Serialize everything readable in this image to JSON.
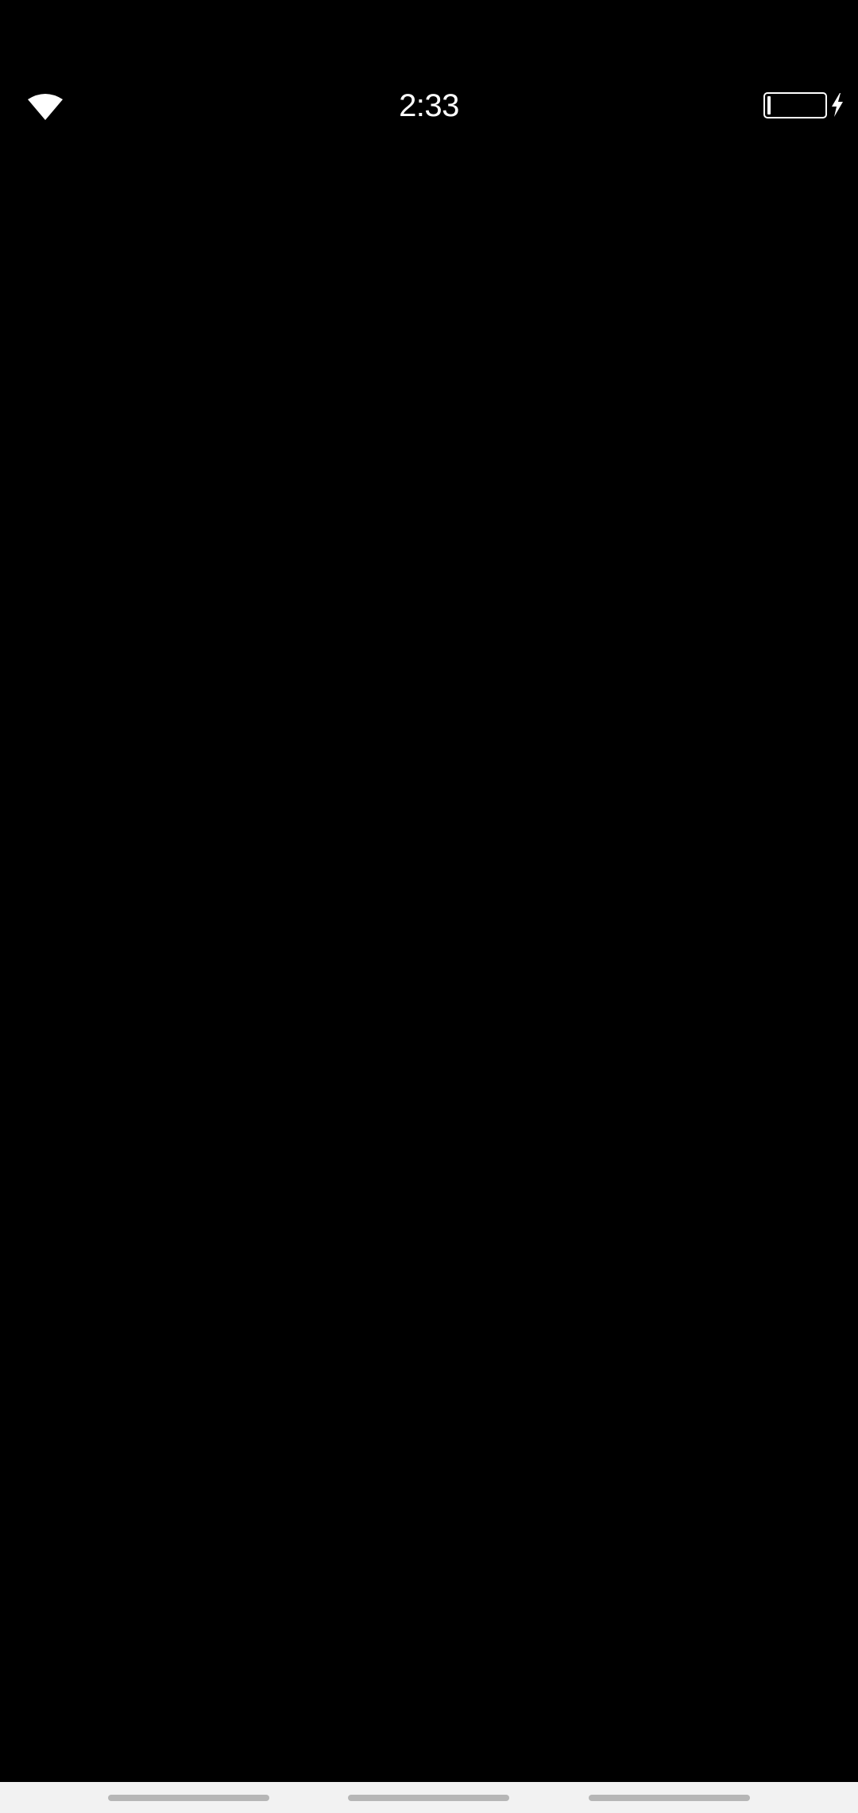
{
  "status_bar": {
    "time": "2:33",
    "wifi_icon": "wifi-icon",
    "battery_icon": "battery-icon",
    "battery_level_percent": 6,
    "charging_icon": "charging-bolt-icon",
    "text_color": "#ffffff"
  },
  "main": {
    "background": "#000000"
  },
  "nav_bar": {
    "background": "#f2f2f2",
    "pill_color": "#b6b6b6",
    "items": [
      "nav-pill-left",
      "nav-pill-center",
      "nav-pill-right"
    ]
  }
}
